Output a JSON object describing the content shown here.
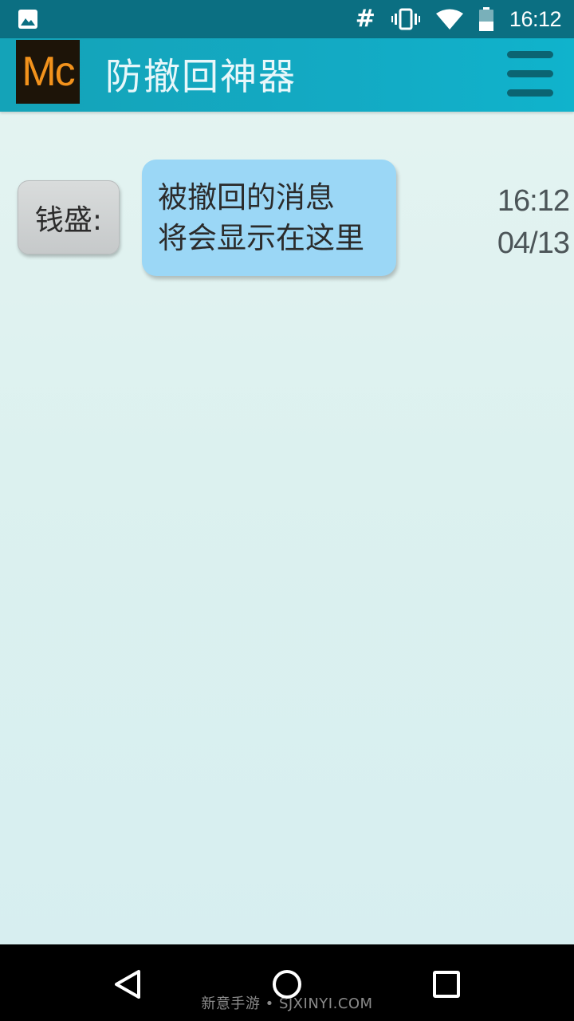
{
  "status_bar": {
    "time": "16:12",
    "icons": [
      "gallery-icon",
      "hash-icon",
      "vibrate-icon",
      "wifi-icon",
      "battery-icon"
    ]
  },
  "app_bar": {
    "logo_text": "Mc",
    "title": "防撤回神器",
    "menu_icon": "hamburger-menu-icon"
  },
  "messages": [
    {
      "sender": "钱盛:",
      "text_lines": [
        "被撤回的消息",
        "将会显示在这里"
      ],
      "time": "16:12",
      "date": "04/13"
    }
  ],
  "nav_bar": {
    "icons": [
      "back-icon",
      "home-icon",
      "recents-icon"
    ]
  },
  "watermark": "新意手游 • SJXINYI.COM",
  "colors": {
    "status_bar": "#0b6f82",
    "app_bar": "#13aac4",
    "bubble": "#9bd7f6",
    "sender_chip": "#cfd2d3",
    "logo_bg": "#1d1408",
    "logo_text": "#f2921c",
    "background": "#dcf1ef"
  }
}
